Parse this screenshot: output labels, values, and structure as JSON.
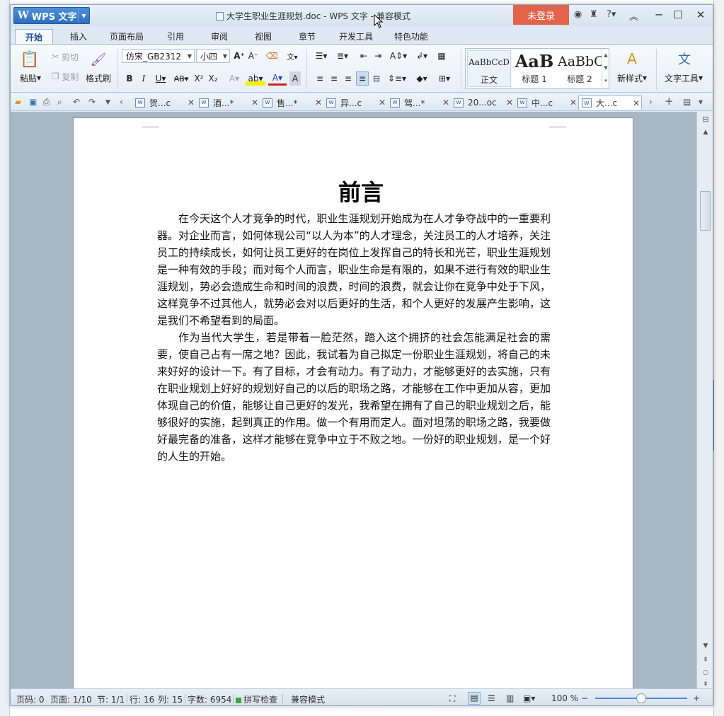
{
  "app": {
    "menu_label": "WPS 文字",
    "logo_glyph": "W",
    "window_title": "大学生职业生涯规划.doc - WPS 文字 - 兼容模式",
    "login_label": "未登录",
    "help_label": "?"
  },
  "tabs": [
    "开始",
    "插入",
    "页面布局",
    "引用",
    "审阅",
    "视图",
    "章节",
    "开发工具",
    "特色功能"
  ],
  "active_tab": "开始",
  "ribbon": {
    "paste_label": "粘贴",
    "cut_label": "剪切",
    "copy_label": "复制",
    "format_painter_label": "格式刷",
    "font_name": "仿宋_GB2312",
    "font_size": "小四",
    "styles": [
      {
        "sample": "AaBbCcD",
        "name": "正文"
      },
      {
        "sample": "AaB",
        "name": "标题 1"
      },
      {
        "sample": "AaBbC",
        "name": "标题 2"
      }
    ],
    "new_style_label": "新样式",
    "text_tools_label": "文字工具"
  },
  "doc_tabs": [
    {
      "label": "贺...c",
      "active": false
    },
    {
      "label": "酒...*",
      "active": false
    },
    {
      "label": "售...*",
      "active": false
    },
    {
      "label": "异...c",
      "active": false
    },
    {
      "label": "驾...*",
      "active": false
    },
    {
      "label": "20...oc",
      "active": false
    },
    {
      "label": "中...c",
      "active": false
    },
    {
      "label": "大...c",
      "active": true
    }
  ],
  "document": {
    "title": "前言",
    "paragraphs": [
      "在今天这个人才竞争的时代，职业生涯规划开始成为在人才争夺战中的一重要利器。对企业而言，如何体现公司“以人为本”的人才理念，关注员工的人才培养，关注员工的持续成长，如何让员工更好的在岗位上发挥自己的特长和光芒，职业生涯规划是一种有效的手段；而对每个人而言，职业生命是有限的，如果不进行有效的职业生涯规划，势必会造成生命和时间的浪费，时间的浪费，就会让你在竞争中处于下风，这样竞争不过其他人，就势必会对以后更好的生活，和个人更好的发展产生影响，这是我们不希望看到的局面。",
      "作为当代大学生，若是带着一脸茫然，踏入这个拥挤的社会怎能满足社会的需要，使自己占有一席之地？因此，我试着为自己拟定一份职业生涯规划，将自己的未来好好的设计一下。有了目标，才会有动力。有了动力，才能够更好的去实施，只有在职业规划上好好的规划好自己的以后的职场之路，才能够在工作中更加从容，更加体现自己的价值，能够让自己更好的发光，我希望在拥有了自己的职业规划之后，能够很好的实施，起到真正的作用。做一个有用而定人。面对坦荡的职场之路，我要做好最完备的准备，这样才能够在竞争中立于不败之地。一份好的职业规划，是一个好的人生的开始。"
    ]
  },
  "status": {
    "page_code": "页码: 0",
    "page": "页面: 1/10",
    "section": "节: 1/1",
    "row": "行: 16",
    "col": "列: 15",
    "word_count": "字数: 6954",
    "spell_check": "拼写检查",
    "compat_mode": "兼容模式",
    "zoom": "100 %",
    "zoom_fraction": 0.5
  },
  "colors": {
    "accent": "#2c6fbe",
    "login_bg": "#e0634a",
    "spell_ok": "#3aa53a"
  }
}
